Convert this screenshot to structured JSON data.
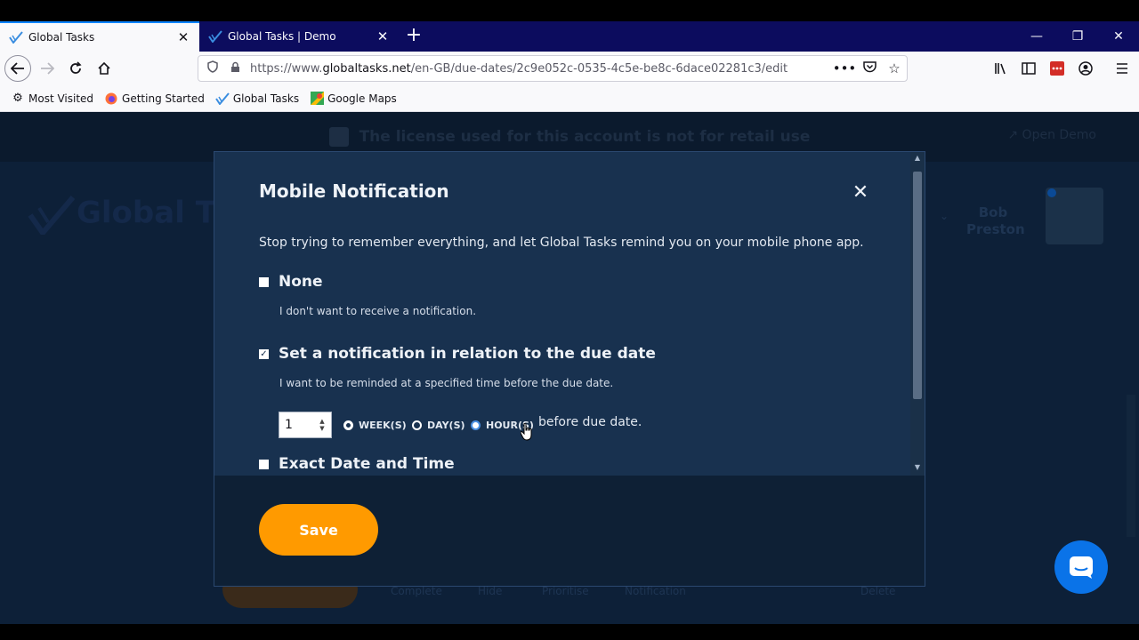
{
  "browser": {
    "tabs": [
      {
        "title": "Global Tasks",
        "active": true
      },
      {
        "title": "Global Tasks | Demo",
        "active": false
      }
    ],
    "new_tab": "+",
    "url": {
      "prefix": "https://www.",
      "domain": "globaltasks.net",
      "path": "/en-GB/due-dates/2c9e052c-0535-4c5e-be8c-6dace02281c3/edit"
    },
    "url_menu": "•••",
    "bookmarks": [
      {
        "label": "Most Visited",
        "icon": "gear-icon"
      },
      {
        "label": "Getting Started",
        "icon": "firefox-icon"
      },
      {
        "label": "Global Tasks",
        "icon": "global-tasks-icon"
      },
      {
        "label": "Google Maps",
        "icon": "maps-icon"
      }
    ]
  },
  "page": {
    "license_notice": "The license used for this account is not for retail use",
    "open_demo": "Open Demo",
    "logo_text": "Global Ta",
    "user_name": "Bob Preston",
    "bg_actions": [
      "Complete",
      "Hide",
      "Prioritise",
      "Notification",
      "Delete"
    ]
  },
  "modal": {
    "title": "Mobile Notification",
    "close_glyph": "✕",
    "intro": "Stop trying to remember everything, and let Global Tasks remind you on your mobile phone app.",
    "options": [
      {
        "title": "None",
        "description": "I don't want to receive a notification.",
        "checked": false
      },
      {
        "title": "Set a notification in relation to the due date",
        "description": "I want to be reminded at a specified time before the due date.",
        "checked": true
      },
      {
        "title": "Exact Date and Time",
        "description": "",
        "checked": false
      }
    ],
    "amount": "1",
    "units": [
      {
        "label": "WEEK(S)",
        "state": "checked"
      },
      {
        "label": "DAY(S)",
        "state": "unchecked"
      },
      {
        "label": "HOUR(S)",
        "state": "hover"
      }
    ],
    "before_text": "before due date.",
    "save_label": "Save"
  },
  "colors": {
    "accent_orange": "#ff9a00",
    "modal_bg": "#18314f",
    "chat_blue": "#0a73e8",
    "tab_strip": "#0c0c5e"
  }
}
